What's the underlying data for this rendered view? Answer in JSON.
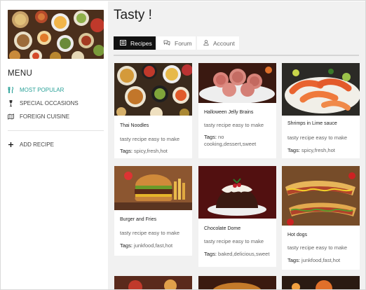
{
  "menu": {
    "title": "MENU",
    "items": [
      {
        "label": "MOST POPULAR",
        "icon": "fork-knife-icon"
      },
      {
        "label": "SPECIAL OCCASIONS",
        "icon": "wine-glass-icon"
      },
      {
        "label": "FOREIGN CUISINE",
        "icon": "map-icon"
      }
    ],
    "add_label": "ADD RECIPE",
    "accent": "#2aa198"
  },
  "header": {
    "title": "Tasty !",
    "tabs": [
      {
        "label": "Recipes",
        "icon": "list-icon"
      },
      {
        "label": "Forum",
        "icon": "chat-icon"
      },
      {
        "label": "Account",
        "icon": "user-icon"
      }
    ]
  },
  "recipes": [
    {
      "name": "Thai Noodles",
      "desc": "tasty recipe easy to make",
      "tags_label": "Tags:",
      "tags": "spicy,fresh,hot"
    },
    {
      "name": "Halloween Jelly Brains",
      "desc": "tasty recipe easy to make",
      "tags_label": "Tags:",
      "tags": "no cooking,dessert,sweet"
    },
    {
      "name": "Shrimps in Lime sauce",
      "desc": "tasty recipe easy to make",
      "tags_label": "Tags:",
      "tags": "spicy,fresh,hot"
    },
    {
      "name": "Burger and Fries",
      "desc": "tasty recipe easy to make",
      "tags_label": "Tags:",
      "tags": "junkfood,fast,hot"
    },
    {
      "name": "Chocolate Dome",
      "desc": "tasty recipe easy to make",
      "tags_label": "Tags:",
      "tags": "baked,delicious,sweet"
    },
    {
      "name": "Hot dogs",
      "desc": "tasty recipe easy to make",
      "tags_label": "Tags:",
      "tags": "junkfood,fast,hot"
    }
  ]
}
